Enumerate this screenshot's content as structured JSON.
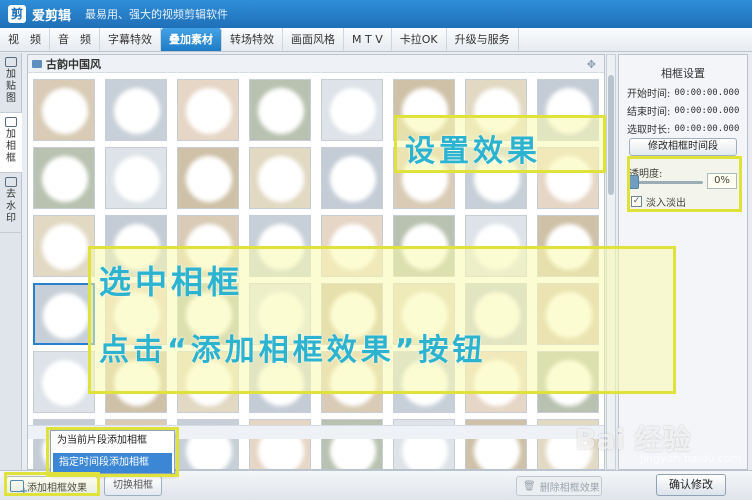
{
  "titlebar": {
    "logo_glyph": "剪",
    "app_name": "爱剪辑",
    "slogan": "最易用、强大的视频剪辑软件"
  },
  "menu": [
    {
      "label": "视　频"
    },
    {
      "label": "音　频"
    },
    {
      "label": "字幕特效"
    },
    {
      "label": "叠加素材",
      "active": true
    },
    {
      "label": "转场特效"
    },
    {
      "label": "画面风格"
    },
    {
      "label": "M T V"
    },
    {
      "label": "卡拉OK"
    },
    {
      "label": "升级与服务"
    }
  ],
  "left_tabs": [
    {
      "label": "加贴图"
    },
    {
      "label": "加相框",
      "active": true
    },
    {
      "label": "去水印"
    }
  ],
  "gallery": {
    "category_title": "古韵中国风",
    "selected_index": 24
  },
  "right_panel": {
    "title": "相框设置",
    "start_label": "开始时间:",
    "start_value": "00:00:00.000",
    "end_label": "结束时间:",
    "end_value": "00:00:00.000",
    "duration_label": "选取时长:",
    "duration_value": "00:00:00.000",
    "modify_button": "修改相框时间段",
    "opacity_label": "透明度:",
    "opacity_value": "0%",
    "fade_label": "淡入淡出",
    "fade_checked": true
  },
  "popup": {
    "item1": "为当前片段添加相框",
    "item2": "指定时间段添加相框"
  },
  "bottom": {
    "add_button": "添加相框效果",
    "second_button": "切换相框",
    "remove_button": "删除相框效果",
    "confirm_button": "确认修改"
  },
  "annotations": {
    "settings": "设置效果",
    "select": "选中相框",
    "click": "点击“添加相框效果”按钮"
  },
  "watermark": {
    "brand": "Bai 经验",
    "url": "jingyan.baidu.com"
  },
  "colors": {
    "titlebar": "#1f6fb8",
    "active_tab": "#2b7fd0",
    "annotation_border": "#dfe23a",
    "annotation_text": "#2bb3d0"
  }
}
